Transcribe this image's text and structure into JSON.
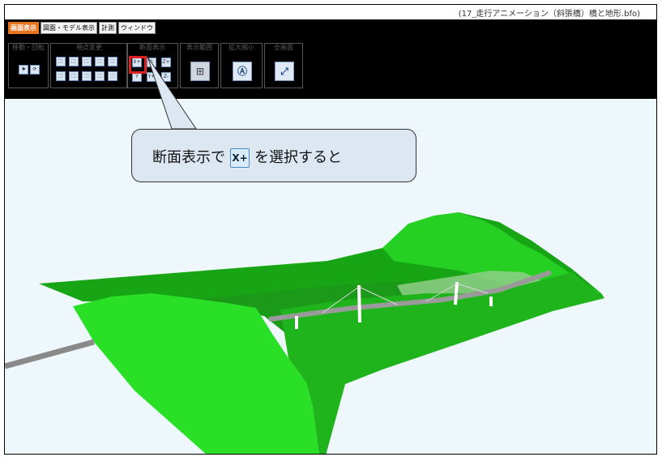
{
  "window": {
    "title": "(17_走行アニメーション（斜張橋）橋と地形.bfo)"
  },
  "tabs": [
    {
      "label": "画面表示",
      "active": true
    },
    {
      "label": "図面・モデル表示",
      "active": false
    },
    {
      "label": "計測",
      "active": false
    },
    {
      "label": "ウィンドウ",
      "active": false
    }
  ],
  "toolbar": {
    "groups": {
      "move": {
        "label": "移動・回転"
      },
      "view": {
        "label": "視点変更"
      },
      "section": {
        "label": "断面表示",
        "buttons": [
          "X+",
          "Y-",
          "Z+",
          "Y",
          "Y+",
          "Z-"
        ]
      },
      "range": {
        "label": "表示範囲"
      },
      "zoom": {
        "label": "拡大縮小"
      },
      "full": {
        "label": "全画面"
      }
    }
  },
  "callout": {
    "prefix": "断面表示で",
    "badge": "X+",
    "suffix": "を選択すると"
  },
  "colors": {
    "terrain": "#1fc21a",
    "toolbar": "#000000",
    "accent": "#e9741e",
    "highlight": "#e02121",
    "sky": "#eef8fc"
  }
}
